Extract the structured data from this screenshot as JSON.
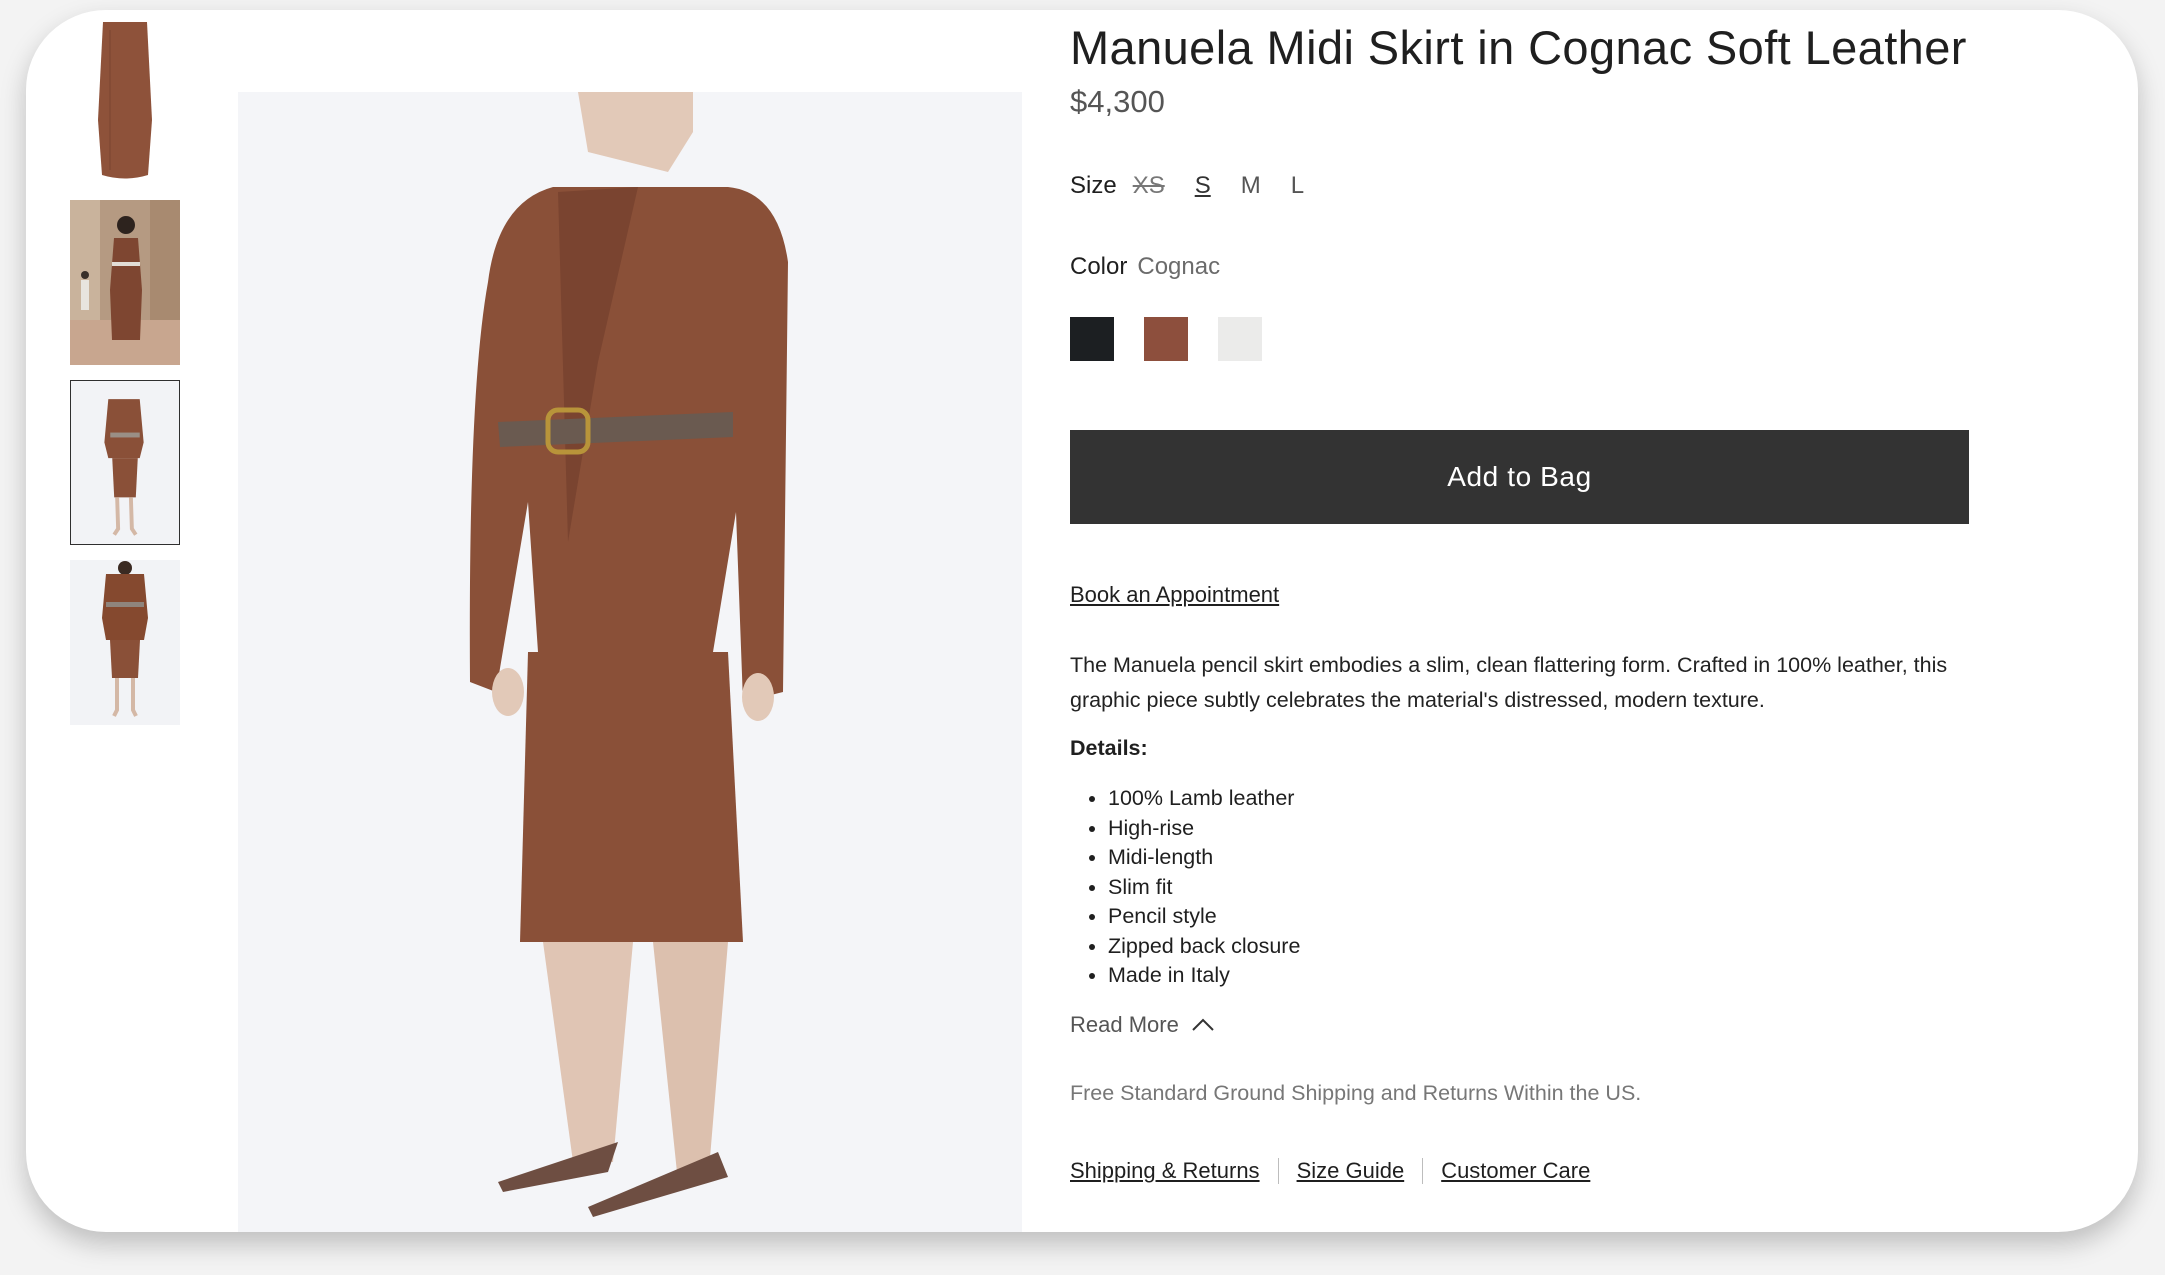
{
  "product": {
    "title": "Manuela Midi Skirt in Cognac Soft Leather",
    "price": "$4,300",
    "size": {
      "label": "Size",
      "options": [
        {
          "label": "XS",
          "state": "unavailable"
        },
        {
          "label": "S",
          "state": "selected"
        },
        {
          "label": "M",
          "state": "available"
        },
        {
          "label": "L",
          "state": "available"
        }
      ]
    },
    "color": {
      "label": "Color",
      "selected": "Cognac",
      "swatches": [
        "#1c1f22",
        "#8d4f3d",
        "#ebebea"
      ]
    },
    "add_to_bag": "Add to Bag",
    "appointment_link": "Book an Appointment",
    "description": "The Manuela pencil skirt embodies a slim, clean flattering form. Crafted in 100% leather, this graphic piece subtly celebrates the material's distressed, modern texture.",
    "details_heading": "Details:",
    "details": [
      "100% Lamb leather",
      "High-rise",
      "Midi-length",
      "Slim fit",
      "Pencil style",
      "Zipped back closure",
      "Made in Italy"
    ],
    "read_more": "Read More",
    "shipping_note": "Free Standard Ground Shipping and Returns Within the US.",
    "footer_links": [
      "Shipping & Returns",
      "Size Guide",
      "Customer Care"
    ]
  },
  "gallery": {
    "active_thumbnail": 3,
    "thumbnail_count": 4
  },
  "colors": {
    "leather": "#8a5038",
    "button": "#333333"
  }
}
